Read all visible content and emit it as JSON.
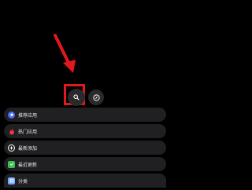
{
  "colors": {
    "background": "#000000",
    "button_bg": "#2a2a2c",
    "menu_item_bg": "#202022",
    "annotation_red": "#e0191f",
    "text": "#e8e8e8"
  },
  "toolbar": {
    "search_icon": "search-icon",
    "compass_icon": "compass-icon"
  },
  "menu": {
    "items": [
      {
        "label": "推荐应用",
        "icon": "star-icon",
        "icon_color": "#4a6cf7"
      },
      {
        "label": "热门应用",
        "icon": "flame-icon",
        "icon_color": "#ef3b3b"
      },
      {
        "label": "最新添加",
        "icon": "plus-icon",
        "icon_color": "#ffffff"
      },
      {
        "label": "最近更新",
        "icon": "update-icon",
        "icon_color": "#3fbf5a"
      },
      {
        "label": "分类",
        "icon": "category-icon",
        "icon_color": "#6fa8ff"
      }
    ]
  }
}
